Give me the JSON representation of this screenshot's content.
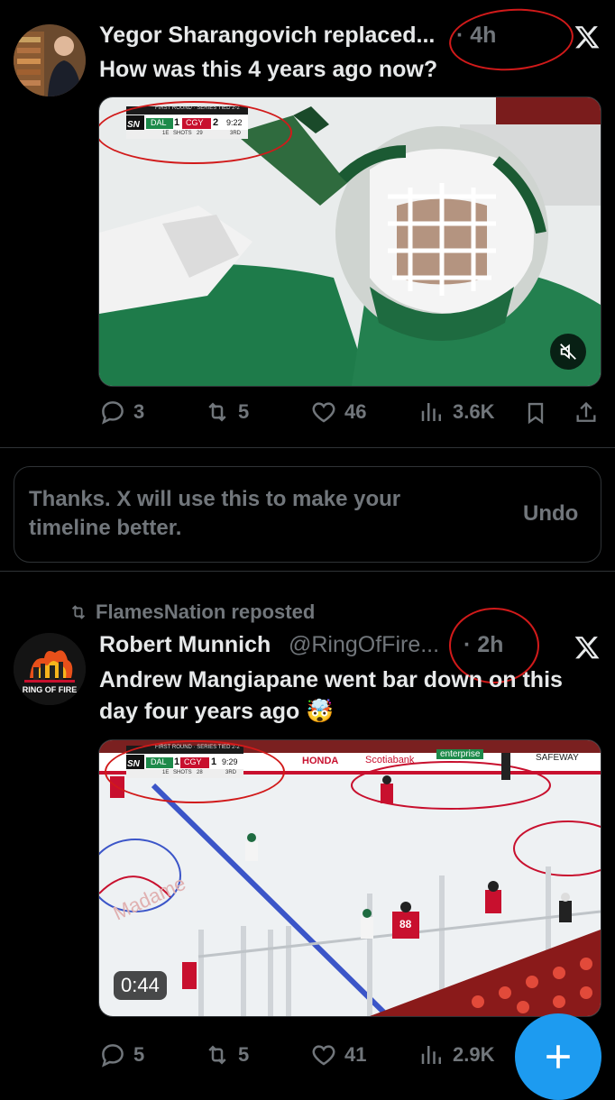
{
  "tweet1": {
    "author_name": "Yegor Sharangovich replaced...",
    "time": "· 4h",
    "text": "How was this 4 years ago now?",
    "scorebug": {
      "round": "FIRST ROUND · SERIES TIED 2-2",
      "network": "SN",
      "team1": "DAL",
      "score1": "1",
      "team2": "CGY",
      "score2": "2",
      "clock": "9:22",
      "period_label": "1E",
      "shots_label": "SHOTS",
      "shots": "29",
      "period": "3RD"
    },
    "actions": {
      "replies": "3",
      "reposts": "5",
      "likes": "46",
      "views": "3.6K"
    }
  },
  "feedback": {
    "message": "Thanks. X will use this to make your timeline better.",
    "undo": "Undo"
  },
  "tweet2": {
    "repost_by": "FlamesNation reposted",
    "author_name": "Robert Munnich",
    "author_handle": "@RingOfFire...",
    "time": "· 2h",
    "text": "Andrew Mangiapane went bar down on this day four years ago 🤯",
    "avatar_label": "RING OF FIRE",
    "scorebug": {
      "round": "FIRST ROUND · SERIES TIED 2-2",
      "network": "SN",
      "team1": "DAL",
      "score1": "1",
      "team2": "CGY",
      "score2": "1",
      "clock": "9:29",
      "period_label": "1E",
      "shots_label": "SHOTS",
      "shots": "28",
      "period": "3RD"
    },
    "boards": [
      "HONDA",
      "Scotiabank",
      "enterprise",
      "SAFEWAY"
    ],
    "jersey": "88",
    "duration": "0:44",
    "actions": {
      "replies": "5",
      "reposts": "5",
      "likes": "41",
      "views": "2.9K"
    }
  },
  "icons": {
    "reply": "reply-icon",
    "repost": "repost-icon",
    "like": "heart-icon",
    "views": "views-icon",
    "bookmark": "bookmark-icon",
    "share": "share-icon",
    "mute": "mute-icon",
    "x": "x-logo-icon",
    "compose": "plus-icon"
  },
  "colors": {
    "background": "#000000",
    "accent": "#1d9bf0",
    "muted": "#71767b",
    "annotation": "#d11a1a"
  }
}
